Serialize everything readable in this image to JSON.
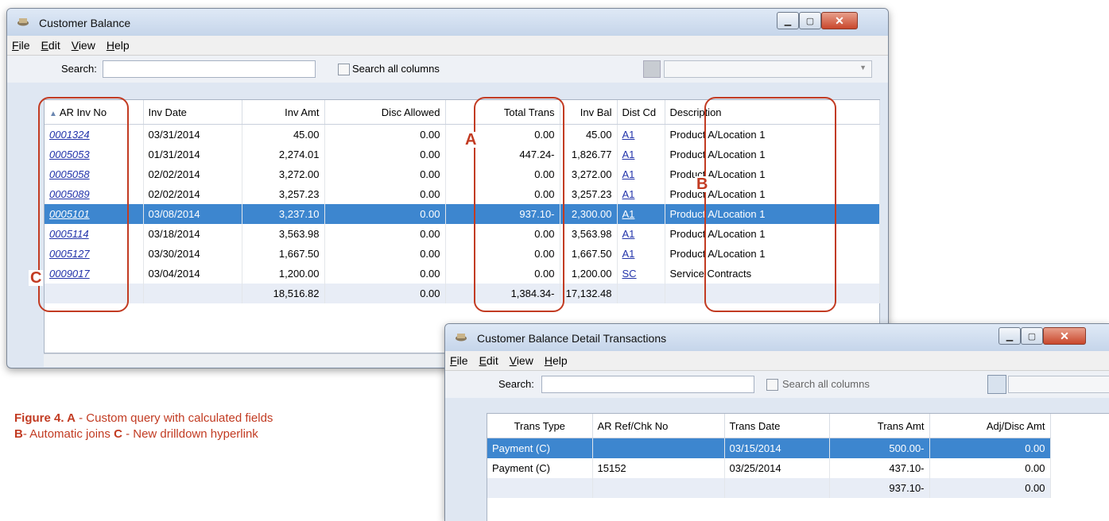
{
  "main_window": {
    "title": "Customer Balance",
    "menu": [
      "File",
      "Edit",
      "View",
      "Help"
    ],
    "search_label": "Search:",
    "search_value": "",
    "search_all_label": "Search all columns",
    "columns": [
      "AR Inv No",
      "Inv Date",
      "Inv Amt",
      "Disc Allowed",
      "Total Trans",
      "Inv Bal",
      "Dist Cd",
      "Description"
    ],
    "rows": [
      [
        "0001324",
        "03/31/2014",
        "45.00",
        "0.00",
        "0.00",
        "45.00",
        "A1",
        "Product A/Location 1"
      ],
      [
        "0005053",
        "01/31/2014",
        "2,274.01",
        "0.00",
        "447.24-",
        "1,826.77",
        "A1",
        "Product A/Location 1"
      ],
      [
        "0005058",
        "02/02/2014",
        "3,272.00",
        "0.00",
        "0.00",
        "3,272.00",
        "A1",
        "Product A/Location 1"
      ],
      [
        "0005089",
        "02/02/2014",
        "3,257.23",
        "0.00",
        "0.00",
        "3,257.23",
        "A1",
        "Product A/Location 1"
      ],
      [
        "0005101",
        "03/08/2014",
        "3,237.10",
        "0.00",
        "937.10-",
        "2,300.00",
        "A1",
        "Product A/Location 1"
      ],
      [
        "0005114",
        "03/18/2014",
        "3,563.98",
        "0.00",
        "0.00",
        "3,563.98",
        "A1",
        "Product A/Location 1"
      ],
      [
        "0005127",
        "03/30/2014",
        "1,667.50",
        "0.00",
        "0.00",
        "1,667.50",
        "A1",
        "Product A/Location 1"
      ],
      [
        "0009017",
        "03/04/2014",
        "1,200.00",
        "0.00",
        "0.00",
        "1,200.00",
        "SC",
        "Service Contracts"
      ]
    ],
    "selected_row": 4,
    "totals": [
      "",
      "",
      "18,516.82",
      "0.00",
      "1,384.34-",
      "17,132.48",
      "",
      ""
    ]
  },
  "detail_window": {
    "title": "Customer Balance Detail Transactions",
    "menu": [
      "File",
      "Edit",
      "View",
      "Help"
    ],
    "search_label": "Search:",
    "search_value": "",
    "search_all_label": "Search all columns",
    "columns": [
      "Trans Type",
      "AR Ref/Chk No",
      "Trans Date",
      "Trans Amt",
      "Adj/Disc Amt"
    ],
    "rows": [
      [
        "Payment (C)",
        "",
        "03/15/2014",
        "500.00-",
        "0.00"
      ],
      [
        "Payment (C)",
        "15152",
        "03/25/2014",
        "437.10-",
        "0.00"
      ]
    ],
    "selected_row": 0,
    "totals": [
      "",
      "",
      "",
      "937.10-",
      "0.00"
    ]
  },
  "callouts": {
    "a": "A",
    "b": "B",
    "c": "C"
  },
  "caption": {
    "a_key": "Figure 4. A",
    "a_text": " - Custom query with calculated fields",
    "b_key": "B",
    "b_text": "- Automatic joins ",
    "c_key": "C",
    "c_text": " - New drilldown hyperlink"
  },
  "colors": {
    "accent": "#c23b22",
    "selection": "#3d86cf",
    "link": "#2233aa"
  }
}
